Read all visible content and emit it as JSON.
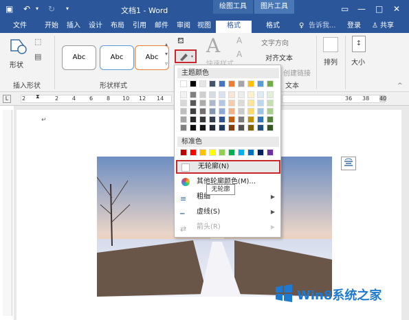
{
  "title_bar": {
    "doc_title": "文档1 - Word",
    "context_drawing": "绘图工具",
    "context_picture": "图片工具",
    "restore_icon": "ribbon-display-icon",
    "minimize": "—",
    "maximize": "□",
    "close": "✕"
  },
  "tabs": [
    "文件",
    "开始",
    "插入",
    "设计",
    "布局",
    "引用",
    "邮件",
    "审阅",
    "视图",
    "格式",
    "格式"
  ],
  "tell_me": "告诉我...",
  "login": "登录",
  "share": "共享",
  "groups": {
    "insert_shapes": "插入形状",
    "shape_styles": "形状样式",
    "wordart": "文本",
    "arrange": "排列",
    "size": "大小"
  },
  "shape_style_samples": [
    "Abc",
    "Abc",
    "Abc"
  ],
  "ribbon_labels": {
    "shapes": "形状",
    "quick_styles": "快速样式",
    "text_direction": "文字方向",
    "align_text": "对齐文本",
    "create_link": "创建链接",
    "arrange_btn": "排列",
    "size_btn": "大小"
  },
  "ruler_ticks": [
    "2",
    "2",
    "4",
    "6",
    "8",
    "10",
    "12",
    "14",
    "36",
    "38",
    "40"
  ],
  "dropdown": {
    "theme_colors": "主题颜色",
    "standard_colors": "标准色",
    "no_outline": "无轮廓(N)",
    "more_colors": "其他轮廓颜色(M)...",
    "weight": "粗细",
    "dashes": "虚线(S)",
    "arrows": "箭头(R)"
  },
  "tooltip": "无轮廓",
  "theme_top": [
    "#ffffff",
    "#000000",
    "#e7e6e6",
    "#44546a",
    "#4472c4",
    "#ed7d31",
    "#a5a5a5",
    "#ffc000",
    "#5b9bd5",
    "#70ad47"
  ],
  "theme_shades": [
    [
      "#f2f2f2",
      "#7f7f7f",
      "#d0cece",
      "#d6dce4",
      "#d9e2f3",
      "#fbe5d5",
      "#ededed",
      "#fff2cc",
      "#deebf6",
      "#e2efd9"
    ],
    [
      "#d8d8d8",
      "#595959",
      "#aeabab",
      "#adb9ca",
      "#b4c6e7",
      "#f7cbac",
      "#dbdbdb",
      "#fee599",
      "#bdd7ee",
      "#c5e0b3"
    ],
    [
      "#bfbfbf",
      "#3f3f3f",
      "#757070",
      "#8496b0",
      "#8eaadb",
      "#f4b183",
      "#c9c9c9",
      "#ffd965",
      "#9cc3e5",
      "#a8d08d"
    ],
    [
      "#a5a5a5",
      "#262626",
      "#3a3838",
      "#323f4f",
      "#2f5496",
      "#c55a11",
      "#7b7b7b",
      "#bf9000",
      "#2e75b5",
      "#538135"
    ],
    [
      "#7f7f7f",
      "#0c0c0c",
      "#171616",
      "#222a35",
      "#1f3864",
      "#833c0b",
      "#525252",
      "#7f6000",
      "#1e4e79",
      "#375623"
    ]
  ],
  "standard": [
    "#c00000",
    "#ff0000",
    "#ffc000",
    "#ffff00",
    "#92d050",
    "#00b050",
    "#00b0f0",
    "#0070c0",
    "#002060",
    "#7030a0"
  ],
  "watermark": "Win8系统之家"
}
